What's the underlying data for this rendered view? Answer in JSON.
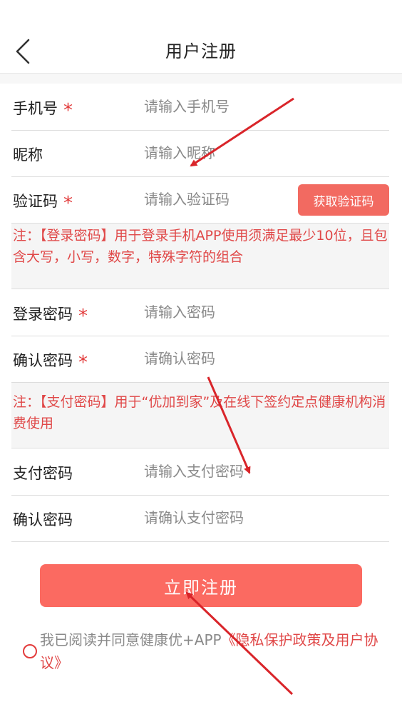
{
  "header": {
    "title": "用户注册"
  },
  "form": {
    "phone": {
      "label": "手机号",
      "placeholder": "请输入手机号"
    },
    "nickname": {
      "label": "昵称",
      "placeholder": "请输入昵称"
    },
    "code": {
      "label": "验证码",
      "placeholder": "请输入验证码",
      "button": "获取验证码"
    },
    "login_note": "注：【登录密码】用于登录手机APP使用须满足最少10位，且包含大写，小写，数字，特殊字符的组合",
    "login_password": {
      "label": "登录密码",
      "placeholder": "请输入密码"
    },
    "confirm_password": {
      "label": "确认密码",
      "placeholder": "请确认密码"
    },
    "pay_note": "注：【支付密码】用于“优加到家”及在线下签约定点健康机构消费使用",
    "pay_password": {
      "label": "支付密码",
      "placeholder": "请输入支付密码"
    },
    "confirm_pay_password": {
      "label": "确认密码",
      "placeholder": "请确认支付密码"
    },
    "required_mark": "*"
  },
  "register_button": "立即注册",
  "agreement": {
    "prefix": "我已阅读并同意健康优+APP",
    "link": "《隐私保护政策及用户协议》"
  },
  "colors": {
    "accent": "#fb6a61",
    "required": "#e23b3b",
    "note_text": "#e04848"
  }
}
